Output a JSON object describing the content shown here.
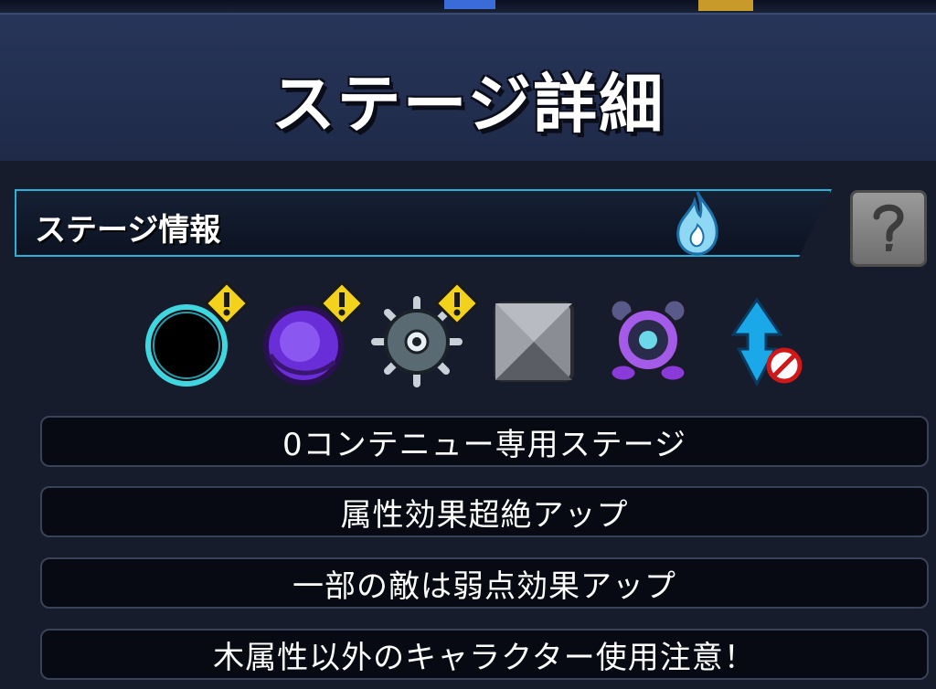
{
  "panel": {
    "title": "ステージ詳細"
  },
  "info_bar": {
    "label": "ステージ情報",
    "element_icon": "wood-flame-icon",
    "help_icon": "question-mark-icon"
  },
  "gimmicks": [
    {
      "icon": "black-hole-icon",
      "warning": true
    },
    {
      "icon": "warp-icon",
      "warning": true
    },
    {
      "icon": "mine-icon",
      "warning": true
    },
    {
      "icon": "block-icon",
      "warning": false
    },
    {
      "icon": "shield-generator-icon",
      "warning": false
    },
    {
      "icon": "speed-down-prohibited-icon",
      "warning": false
    }
  ],
  "info_rows": [
    "0コンテニュー専用ステージ",
    "属性効果超絶アップ",
    "一部の敵は弱点効果アップ",
    "木属性以外のキャラクター使用注意！"
  ],
  "colors": {
    "accent": "#2bb0d6",
    "warning": "#f2d21a",
    "panel_bg": "#1c2438"
  }
}
